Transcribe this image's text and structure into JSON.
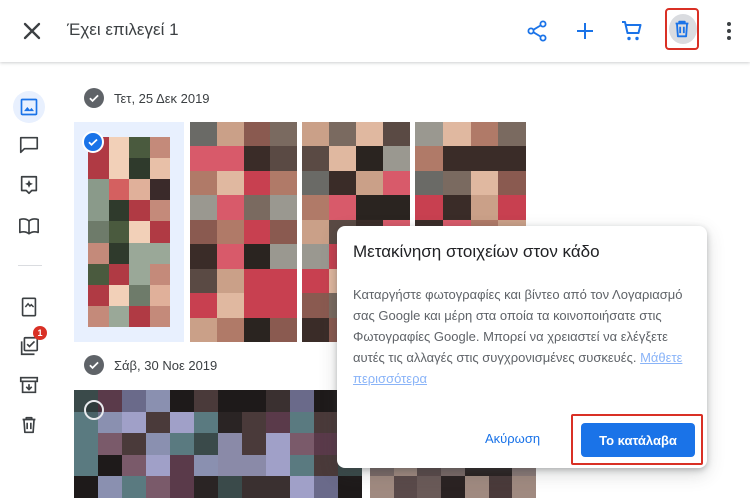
{
  "toolbar": {
    "title": "Έχει επιλεγεί 1",
    "icons": [
      "close-icon",
      "share-icon",
      "add-icon",
      "cart-icon",
      "delete-icon",
      "more-vert-icon"
    ],
    "accent": "#1a73e8"
  },
  "rail": {
    "items": [
      "photos-icon",
      "sharing-icon",
      "assistant-icon",
      "albums-icon",
      "photo-book-icon",
      "utilities-icon",
      "archive-icon",
      "trash-icon"
    ],
    "badge": "1"
  },
  "groups": [
    {
      "date": "Τετ, 25 Δεκ 2019"
    },
    {
      "date": "Σάβ, 30 Νοε 2019"
    }
  ],
  "dialog": {
    "title": "Μετακίνηση στοιχείων στον κάδο",
    "body": "Καταργήστε φωτογραφίες και βίντεο από τον Λογαριασμό σας Google και μέρη στα οποία τα κοινοποιήσατε στις Φωτογραφίες Google. Μπορεί να χρειαστεί να ελέγξετε αυτές τις αλλαγές στις συγχρονισμένες συσκευές.",
    "link": "Μάθετε περισσότερα",
    "cancel": "Ακύρωση",
    "ok": "Το κατάλαβα"
  }
}
